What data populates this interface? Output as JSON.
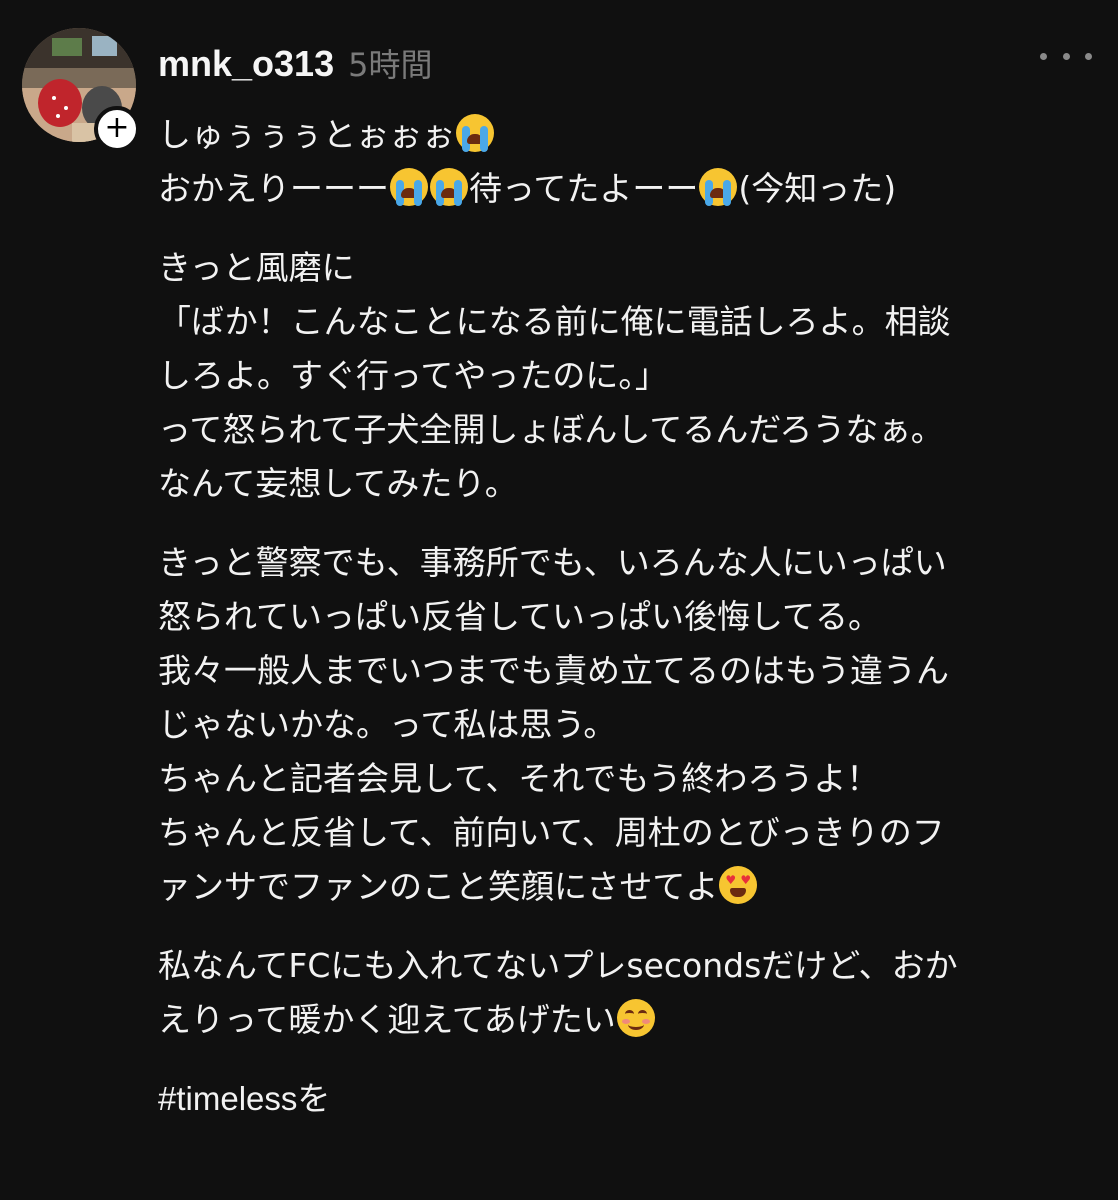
{
  "post": {
    "username": "mnk_o313",
    "timestamp": "5時間",
    "follow_icon": "plus-icon",
    "more_icon": "more-horizontal-icon",
    "avatar_icon": "user-avatar-photo",
    "emoji_names": [
      "loudly-crying-face",
      "smiling-face-with-heart-eyes",
      "smiling-face-with-smiling-eyes"
    ],
    "body": {
      "p1_l1": "しゅぅぅぅとぉぉぉ",
      "p1_l2_a": "おかえりーーー",
      "p1_l2_b": "待ってたよーー",
      "p1_l2_c": "(今知った)",
      "p2_l1": "きっと風磨に",
      "p2_l2": "「ばか！こんなことになる前に俺に電話しろよ。相談",
      "p2_l3": "しろよ。すぐ行ってやったのに。」",
      "p2_l4": "って怒られて子犬全開しょぼんしてるんだろうなぁ。",
      "p2_l5": "なんて妄想してみたり。",
      "p3_l1": "きっと警察でも、事務所でも、いろんな人にいっぱい",
      "p3_l2": "怒られていっぱい反省していっぱい後悔してる。",
      "p3_l3": "我々一般人までいつまでも責め立てるのはもう違うん",
      "p3_l4": "じゃないかな。って私は思う。",
      "p3_l5": "ちゃんと記者会見して、それでもう終わろうよ！",
      "p3_l6": "ちゃんと反省して、前向いて、周杜のとびっきりのフ",
      "p3_l7": "ァンサでファンのこと笑顔にさせてよ",
      "p4_l1": "私なんてFCにも入れてないプレsecondsだけど、おか",
      "p4_l2": "えりって暖かく迎えてあげたい",
      "hashtag": "#timelessを"
    }
  }
}
